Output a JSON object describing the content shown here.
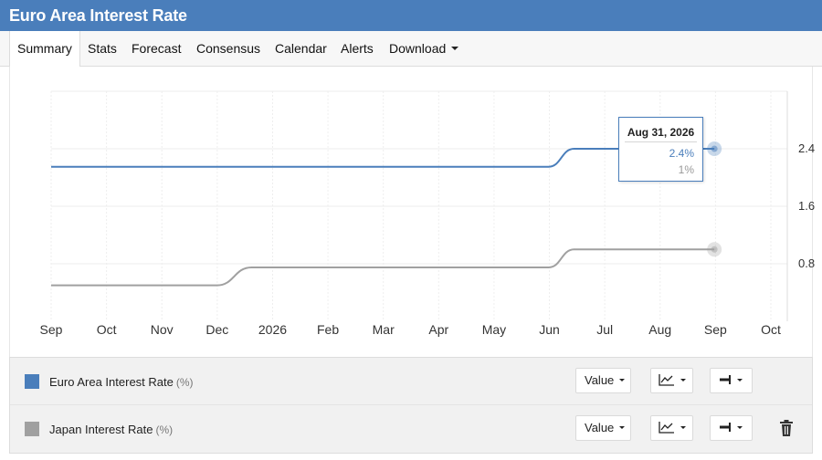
{
  "page": {
    "title": "Euro Area Interest Rate"
  },
  "tabs": [
    {
      "label": "Summary",
      "active": true
    },
    {
      "label": "Stats"
    },
    {
      "label": "Forecast"
    },
    {
      "label": "Consensus"
    },
    {
      "label": "Calendar"
    },
    {
      "label": "Alerts"
    },
    {
      "label": "Download",
      "dropdown": true
    }
  ],
  "tooltip": {
    "date": "Aug 31, 2026",
    "value_1": "2.4%",
    "value_2": "1%"
  },
  "chart_data": {
    "type": "line",
    "x_labels": [
      "Sep",
      "Oct",
      "Nov",
      "Dec",
      "2026",
      "Feb",
      "Mar",
      "Apr",
      "May",
      "Jun",
      "Jul",
      "Aug",
      "Sep",
      "Oct"
    ],
    "y_ticks": [
      "0.8",
      "1.6",
      "2.4"
    ],
    "ylim": [
      0,
      3.2
    ],
    "y_axis_position": "right",
    "grid": true,
    "series": [
      {
        "name": "Euro Area Interest Rate",
        "unit": "(%)",
        "color": "#4a7ebb",
        "points": [
          {
            "x": "2025-09-01",
            "y": 2.15
          },
          {
            "x": "2026-06-01",
            "y": 2.15
          },
          {
            "x": "2026-06-15",
            "y": 2.4
          },
          {
            "x": "2026-08-31",
            "y": 2.4
          }
        ]
      },
      {
        "name": "Japan Interest Rate",
        "unit": "(%)",
        "color": "#a0a0a0",
        "points": [
          {
            "x": "2025-09-01",
            "y": 0.5
          },
          {
            "x": "2025-12-01",
            "y": 0.5
          },
          {
            "x": "2025-12-20",
            "y": 0.75
          },
          {
            "x": "2026-06-01",
            "y": 0.75
          },
          {
            "x": "2026-06-15",
            "y": 1.0
          },
          {
            "x": "2026-08-31",
            "y": 1.0
          }
        ]
      }
    ]
  },
  "legend": {
    "value_label": "Value",
    "icons": {
      "chart_type": "line-chart-icon",
      "axis": "axis-right-icon",
      "delete": "trash-icon"
    }
  }
}
